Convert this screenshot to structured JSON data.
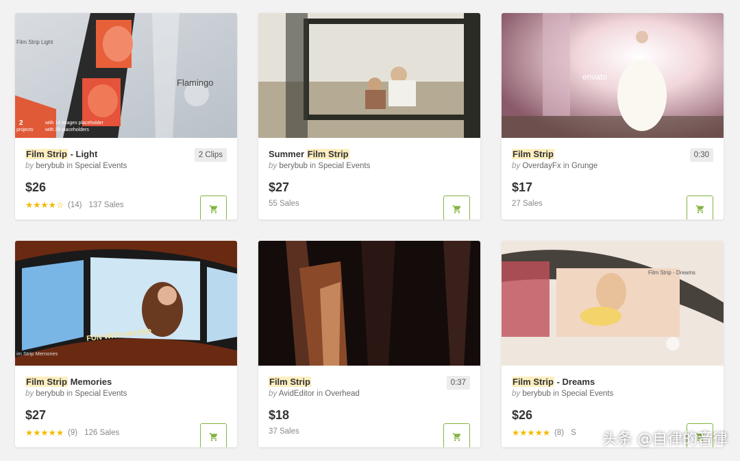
{
  "accent_color": "#82b440",
  "star_color": "#f6b900",
  "highlight_color": "#fdeebf",
  "cards": [
    {
      "title_pre": "",
      "title_hl": "Film Strip",
      "title_post": " - Light",
      "by": "by",
      "author": "berybub",
      "in": "in",
      "category": "Special Events",
      "badge": "2 Clips",
      "price": "$26",
      "stars_text": "★★★★☆",
      "rating": 4.0,
      "rating_count": "(14)",
      "sales": "137 Sales",
      "thumb_text": [
        "Film Strip Light",
        "Flamingo",
        "2",
        "projects",
        "with 14 images placeholder",
        "with 28 placeholders"
      ],
      "cart_icon": "cart-icon"
    },
    {
      "title_pre": "Summer ",
      "title_hl": "Film Strip",
      "title_post": "",
      "by": "by",
      "author": "berybub",
      "in": "in",
      "category": "Special Events",
      "badge": "",
      "price": "$27",
      "stars_text": "",
      "rating_count": "",
      "sales": "55 Sales",
      "cart_icon": "cart-icon"
    },
    {
      "title_pre": "",
      "title_hl": "Film Strip",
      "title_post": "",
      "by": "by",
      "author": "OverdayFx",
      "in": "in",
      "category": "Grunge",
      "badge": "0:30",
      "price": "$17",
      "stars_text": "",
      "rating_count": "",
      "sales": "27 Sales",
      "thumb_text": [
        "envato"
      ],
      "cart_icon": "cart-icon"
    },
    {
      "title_pre": "",
      "title_hl": "Film Strip",
      "title_post": " Memories",
      "by": "by",
      "author": "berybub",
      "in": "in",
      "category": "Special Events",
      "badge": "",
      "price": "$27",
      "stars_text": "★★★★★",
      "rating": 4.5,
      "rating_count": "(9)",
      "sales": "126 Sales",
      "thumb_text": [
        "FUN WITH WATER",
        "im Strip Memories"
      ],
      "cart_icon": "cart-icon"
    },
    {
      "title_pre": "",
      "title_hl": "Film Strip",
      "title_post": "",
      "by": "by",
      "author": "AvidEditor",
      "in": "in",
      "category": "Overhead",
      "badge": "0:37",
      "price": "$18",
      "stars_text": "",
      "rating_count": "",
      "sales": "37 Sales",
      "cart_icon": "cart-icon"
    },
    {
      "title_pre": "",
      "title_hl": "Film Strip",
      "title_post": " - Dreams",
      "by": "by",
      "author": "berybub",
      "in": "in",
      "category": "Special Events",
      "badge": "",
      "price": "$26",
      "stars_text": "★★★★★",
      "rating": 4.5,
      "rating_count": "(8)",
      "sales": "S",
      "thumb_text": [
        "Film Strip - Dreams"
      ],
      "cart_icon": "cart-icon"
    }
  ],
  "watermark": "头条 @自律的音律"
}
